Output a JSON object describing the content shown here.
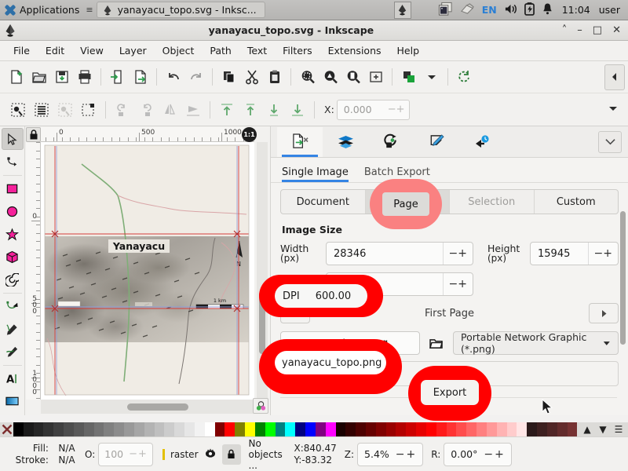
{
  "taskbar": {
    "applications_label": "Applications",
    "window_button_label": "yanayacu_topo.svg - Inksc...",
    "language": "EN",
    "clock": "11:04",
    "user": "user",
    "icons": [
      "xfce-logo-icon",
      "grip-icon",
      "inkscape-icon",
      "clipboard-icon",
      "eraser-icon",
      "volume-icon",
      "battery-icon",
      "bell-icon"
    ]
  },
  "window": {
    "title": "yanayacu_topo.svg - Inkscape",
    "buttons": {
      "shade": "˄",
      "minimize": "–",
      "maximize": "□",
      "close": "✕"
    }
  },
  "menu": {
    "items": [
      "File",
      "Edit",
      "View",
      "Layer",
      "Object",
      "Path",
      "Text",
      "Filters",
      "Extensions",
      "Help"
    ]
  },
  "command_toolbar": {
    "icons": [
      "new-document-icon",
      "open-document-icon",
      "save-document-icon",
      "print-icon",
      "import-icon",
      "export-icon",
      "undo-icon",
      "redo-icon",
      "copy-icon",
      "cut-icon",
      "paste-icon",
      "zoom-selection-icon",
      "zoom-drawing-icon",
      "zoom-page-icon",
      "zoom-page-width-icon",
      "duplicate-icon",
      "dropdown-icon",
      "reset-icon",
      "collapse-panel-icon"
    ]
  },
  "control_bar": {
    "icons": [
      "select-all-icon",
      "select-all-layers-icon",
      "deselect-icon",
      "select-same-icon",
      "rotate-ccw-icon",
      "rotate-cw-icon",
      "flip-horizontal-icon",
      "flip-vertical-icon",
      "raise-to-top-icon",
      "raise-icon",
      "lower-icon",
      "lower-to-bottom-icon",
      "overflow-dropdown-icon"
    ],
    "x_label": "X:",
    "x_value": "0.000"
  },
  "toolbox": {
    "tools": [
      {
        "name": "selector-tool",
        "icon": "arrow-cursor-icon",
        "selected": true
      },
      {
        "name": "node-tool",
        "icon": "node-editor-icon",
        "selected": false
      },
      {
        "name": "rectangle-tool",
        "icon": "square-icon",
        "selected": false
      },
      {
        "name": "ellipse-tool",
        "icon": "circle-icon",
        "selected": false
      },
      {
        "name": "star-tool",
        "icon": "star-icon",
        "selected": false
      },
      {
        "name": "3dbox-tool",
        "icon": "cube-icon",
        "selected": false
      },
      {
        "name": "spiral-tool",
        "icon": "spiral-icon",
        "selected": false
      },
      {
        "name": "pen-tool",
        "icon": "bezier-pen-icon",
        "selected": false
      },
      {
        "name": "pencil-tool",
        "icon": "pencil-icon",
        "selected": false
      },
      {
        "name": "calligraphy-tool",
        "icon": "calligraphy-brush-icon",
        "selected": false
      },
      {
        "name": "text-tool",
        "icon": "text-a-icon",
        "selected": false
      },
      {
        "name": "gradient-tool",
        "icon": "gradient-icon",
        "selected": false
      }
    ]
  },
  "canvas": {
    "lock_icon": "lock-closed-icon",
    "zoom_badge": "1:1",
    "ruler_h_labels": [
      "0",
      "500",
      "1000"
    ],
    "ruler_v_labels": [
      "0",
      "500",
      "1000"
    ],
    "map_title": "Yanayacu",
    "map_scale_label": "1 km",
    "map_compass_label": "N",
    "wheel_icon": "color-wheel-icon"
  },
  "dock": {
    "tab_icons": [
      "export-dialog-icon",
      "layers-icon",
      "object-properties-icon",
      "fill-stroke-icon",
      "undo-history-icon"
    ],
    "collapse_icon": "chevron-down-icon",
    "subtabs": [
      {
        "label": "Single Image",
        "active": true
      },
      {
        "label": "Batch Export",
        "active": false
      }
    ],
    "area_segments": [
      {
        "label": "Document",
        "state": "normal"
      },
      {
        "label": "Page",
        "state": "selected"
      },
      {
        "label": "Selection",
        "state": "disabled"
      },
      {
        "label": "Custom",
        "state": "normal"
      }
    ],
    "image_size_title": "Image Size",
    "width_label": "Width",
    "width_unit": "(px)",
    "width_value": "28346",
    "height_label": "Height",
    "height_unit": "(px)",
    "height_value": "15945",
    "dpi_label": "DPI",
    "dpi_value": "600.00",
    "page_prev_icon": "triangle-left-icon",
    "page_next_icon": "triangle-right-icon",
    "page_label": "First Page",
    "filename_value": "yanayacu_topo.png",
    "folder_icon": "folder-open-icon",
    "filetype_value": "Portable Network Graphic (*.png)",
    "filetype_caret": "chevron-down-icon",
    "export_label": "Export"
  },
  "palette": {
    "no_color_icon": "x-no-color-icon",
    "scroll_up_icon": "chevron-up-icon",
    "scroll_down_icon": "chevron-down-icon",
    "menu_icon": "hamburger-menu-icon",
    "swatches": [
      "#000000",
      "#1a1a1a",
      "#262626",
      "#333333",
      "#404040",
      "#4d4d4d",
      "#595959",
      "#666666",
      "#737373",
      "#808080",
      "#8c8c8c",
      "#999999",
      "#a6a6a6",
      "#b3b3b3",
      "#bfbfbf",
      "#cccccc",
      "#d9d9d9",
      "#e6e6e6",
      "#f2f2f2",
      "#ffffff",
      "#800000",
      "#ff0000",
      "#808000",
      "#ffff00",
      "#008000",
      "#00ff00",
      "#008080",
      "#00ffff",
      "#000080",
      "#0000ff",
      "#800080",
      "#ff00ff",
      "#1a0000",
      "#330000",
      "#4d0000",
      "#660000",
      "#800000",
      "#990000",
      "#b30000",
      "#cc0000",
      "#e60000",
      "#ff0000",
      "#ff1a1a",
      "#ff3333",
      "#ff4d4d",
      "#ff6666",
      "#ff8080",
      "#ff9999",
      "#ffb3b3",
      "#ffcccc",
      "#ffe6e6",
      "#2b1a1a",
      "#3d2020",
      "#502626",
      "#632c2c",
      "#763232"
    ]
  },
  "status": {
    "fill_label": "Fill:",
    "fill_value": "N/A",
    "stroke_label": "Stroke:",
    "stroke_value": "N/A",
    "opacity_label": "O:",
    "opacity_value": "100",
    "layer_name": "raster",
    "layer_visibility_icon": "eye-open-icon",
    "layer_lock_icon": "lock-closed-icon",
    "selection_text_line1": "No",
    "selection_text_line2": "objects ...",
    "x_label": "X:",
    "x_value": "840.47",
    "y_label": "Y:",
    "y_value": "-83.32",
    "zoom_label": "Z:",
    "zoom_value": "5.4%",
    "rotate_label": "R:",
    "rotate_value": "0.00°"
  },
  "annotations": {
    "color_solid": "#ff0000",
    "color_light": "#fa8181",
    "highlighted": [
      "Page",
      "DPI 600.00",
      "yanayacu_topo.png",
      "Export"
    ]
  }
}
